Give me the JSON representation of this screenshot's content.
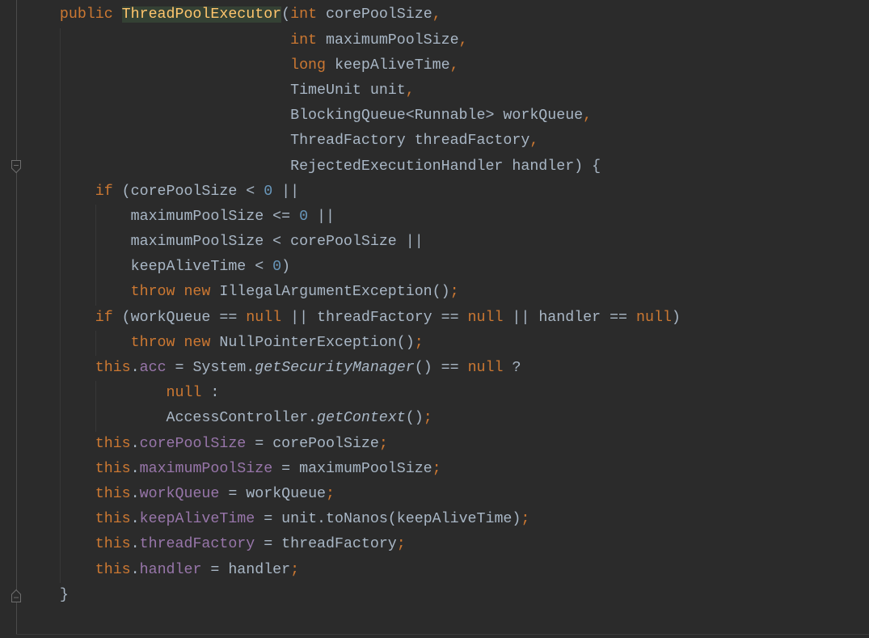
{
  "theme": {
    "background": "#2b2b2b",
    "gutter_separator": "#4b4b4b",
    "indent_guide": "#373737",
    "fold_marker": "#6e6e6e"
  },
  "gutter": {
    "fold_icons": [
      "fold-start-icon",
      "fold-end-icon"
    ]
  },
  "editor": {
    "lines": [
      {
        "segments": [
          {
            "text": "public ",
            "color": "#cc7832"
          },
          {
            "text": "ThreadPoolExecutor",
            "color": "#ffc66d",
            "highlight": "#344134"
          },
          {
            "text": "(",
            "color": "#a9b7c6"
          },
          {
            "text": "int ",
            "color": "#cc7832"
          },
          {
            "text": "corePoolSize",
            "color": "#a9b7c6"
          },
          {
            "text": ",",
            "color": "#cc7832"
          }
        ]
      },
      {
        "segments": [
          {
            "text": "int ",
            "color": "#cc7832"
          },
          {
            "text": "maximumPoolSize",
            "color": "#a9b7c6"
          },
          {
            "text": ",",
            "color": "#cc7832"
          }
        ]
      },
      {
        "segments": [
          {
            "text": "long ",
            "color": "#cc7832"
          },
          {
            "text": "keepAliveTime",
            "color": "#a9b7c6"
          },
          {
            "text": ",",
            "color": "#cc7832"
          }
        ]
      },
      {
        "segments": [
          {
            "text": "TimeUnit unit",
            "color": "#a9b7c6"
          },
          {
            "text": ",",
            "color": "#cc7832"
          }
        ]
      },
      {
        "segments": [
          {
            "text": "BlockingQueue<Runnable> workQueue",
            "color": "#a9b7c6"
          },
          {
            "text": ",",
            "color": "#cc7832"
          }
        ]
      },
      {
        "segments": [
          {
            "text": "ThreadFactory threadFactory",
            "color": "#a9b7c6"
          },
          {
            "text": ",",
            "color": "#cc7832"
          }
        ]
      },
      {
        "segments": [
          {
            "text": "RejectedExecutionHandler handler) {",
            "color": "#a9b7c6"
          }
        ]
      },
      {
        "segments": [
          {
            "text": "if ",
            "color": "#cc7832"
          },
          {
            "text": "(corePoolSize < ",
            "color": "#a9b7c6"
          },
          {
            "text": "0",
            "color": "#6897bb"
          },
          {
            "text": " ||",
            "color": "#a9b7c6"
          }
        ]
      },
      {
        "segments": [
          {
            "text": "maximumPoolSize <= ",
            "color": "#a9b7c6"
          },
          {
            "text": "0",
            "color": "#6897bb"
          },
          {
            "text": " ||",
            "color": "#a9b7c6"
          }
        ]
      },
      {
        "segments": [
          {
            "text": "maximumPoolSize < corePoolSize ||",
            "color": "#a9b7c6"
          }
        ]
      },
      {
        "segments": [
          {
            "text": "keepAliveTime < ",
            "color": "#a9b7c6"
          },
          {
            "text": "0",
            "color": "#6897bb"
          },
          {
            "text": ")",
            "color": "#a9b7c6"
          }
        ]
      },
      {
        "segments": [
          {
            "text": "throw new ",
            "color": "#cc7832"
          },
          {
            "text": "IllegalArgumentException()",
            "color": "#a9b7c6"
          },
          {
            "text": ";",
            "color": "#cc7832"
          }
        ]
      },
      {
        "segments": [
          {
            "text": "if ",
            "color": "#cc7832"
          },
          {
            "text": "(workQueue == ",
            "color": "#a9b7c6"
          },
          {
            "text": "null",
            "color": "#cc7832"
          },
          {
            "text": " || threadFactory == ",
            "color": "#a9b7c6"
          },
          {
            "text": "null",
            "color": "#cc7832"
          },
          {
            "text": " || handler == ",
            "color": "#a9b7c6"
          },
          {
            "text": "null",
            "color": "#cc7832"
          },
          {
            "text": ")",
            "color": "#a9b7c6"
          }
        ]
      },
      {
        "segments": [
          {
            "text": "throw new ",
            "color": "#cc7832"
          },
          {
            "text": "NullPointerException()",
            "color": "#a9b7c6"
          },
          {
            "text": ";",
            "color": "#cc7832"
          }
        ]
      },
      {
        "segments": [
          {
            "text": "this",
            "color": "#cc7832"
          },
          {
            "text": ".",
            "color": "#a9b7c6"
          },
          {
            "text": "acc",
            "color": "#9876aa"
          },
          {
            "text": " = System.",
            "color": "#a9b7c6"
          },
          {
            "text": "getSecurityManager",
            "color": "#a9b7c6",
            "italic": true
          },
          {
            "text": "() == ",
            "color": "#a9b7c6"
          },
          {
            "text": "null",
            "color": "#cc7832"
          },
          {
            "text": " ?",
            "color": "#a9b7c6"
          }
        ]
      },
      {
        "segments": [
          {
            "text": "null",
            "color": "#cc7832"
          },
          {
            "text": " :",
            "color": "#a9b7c6"
          }
        ]
      },
      {
        "segments": [
          {
            "text": "AccessController.",
            "color": "#a9b7c6"
          },
          {
            "text": "getContext",
            "color": "#a9b7c6",
            "italic": true
          },
          {
            "text": "()",
            "color": "#a9b7c6"
          },
          {
            "text": ";",
            "color": "#cc7832"
          }
        ]
      },
      {
        "segments": [
          {
            "text": "this",
            "color": "#cc7832"
          },
          {
            "text": ".",
            "color": "#a9b7c6"
          },
          {
            "text": "corePoolSize",
            "color": "#9876aa"
          },
          {
            "text": " = corePoolSize",
            "color": "#a9b7c6"
          },
          {
            "text": ";",
            "color": "#cc7832"
          }
        ]
      },
      {
        "segments": [
          {
            "text": "this",
            "color": "#cc7832"
          },
          {
            "text": ".",
            "color": "#a9b7c6"
          },
          {
            "text": "maximumPoolSize",
            "color": "#9876aa"
          },
          {
            "text": " = maximumPoolSize",
            "color": "#a9b7c6"
          },
          {
            "text": ";",
            "color": "#cc7832"
          }
        ]
      },
      {
        "segments": [
          {
            "text": "this",
            "color": "#cc7832"
          },
          {
            "text": ".",
            "color": "#a9b7c6"
          },
          {
            "text": "workQueue",
            "color": "#9876aa"
          },
          {
            "text": " = workQueue",
            "color": "#a9b7c6"
          },
          {
            "text": ";",
            "color": "#cc7832"
          }
        ]
      },
      {
        "segments": [
          {
            "text": "this",
            "color": "#cc7832"
          },
          {
            "text": ".",
            "color": "#a9b7c6"
          },
          {
            "text": "keepAliveTime",
            "color": "#9876aa"
          },
          {
            "text": " = unit.toNanos(keepAliveTime)",
            "color": "#a9b7c6"
          },
          {
            "text": ";",
            "color": "#cc7832"
          }
        ]
      },
      {
        "segments": [
          {
            "text": "this",
            "color": "#cc7832"
          },
          {
            "text": ".",
            "color": "#a9b7c6"
          },
          {
            "text": "threadFactory",
            "color": "#9876aa"
          },
          {
            "text": " = threadFactory",
            "color": "#a9b7c6"
          },
          {
            "text": ";",
            "color": "#cc7832"
          }
        ]
      },
      {
        "segments": [
          {
            "text": "this",
            "color": "#cc7832"
          },
          {
            "text": ".",
            "color": "#a9b7c6"
          },
          {
            "text": "handler",
            "color": "#9876aa"
          },
          {
            "text": " = handler",
            "color": "#a9b7c6"
          },
          {
            "text": ";",
            "color": "#cc7832"
          }
        ]
      },
      {
        "segments": [
          {
            "text": "}",
            "color": "#a9b7c6"
          }
        ]
      }
    ]
  }
}
